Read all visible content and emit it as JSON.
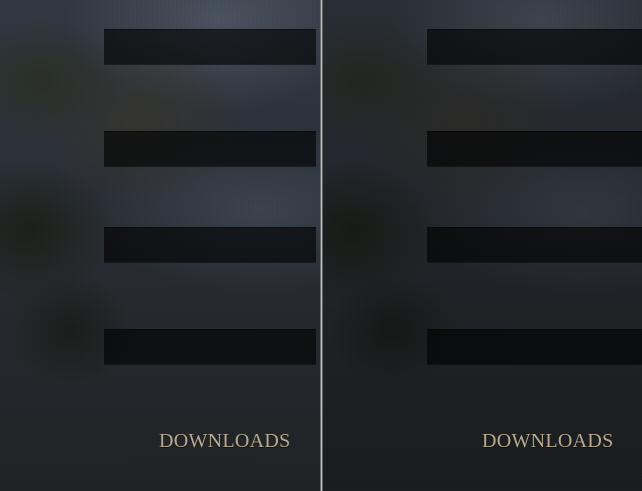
{
  "panels": {
    "left": {
      "label": "DOWNLOADS"
    },
    "right": {
      "label": "DOWNLOADS"
    }
  }
}
